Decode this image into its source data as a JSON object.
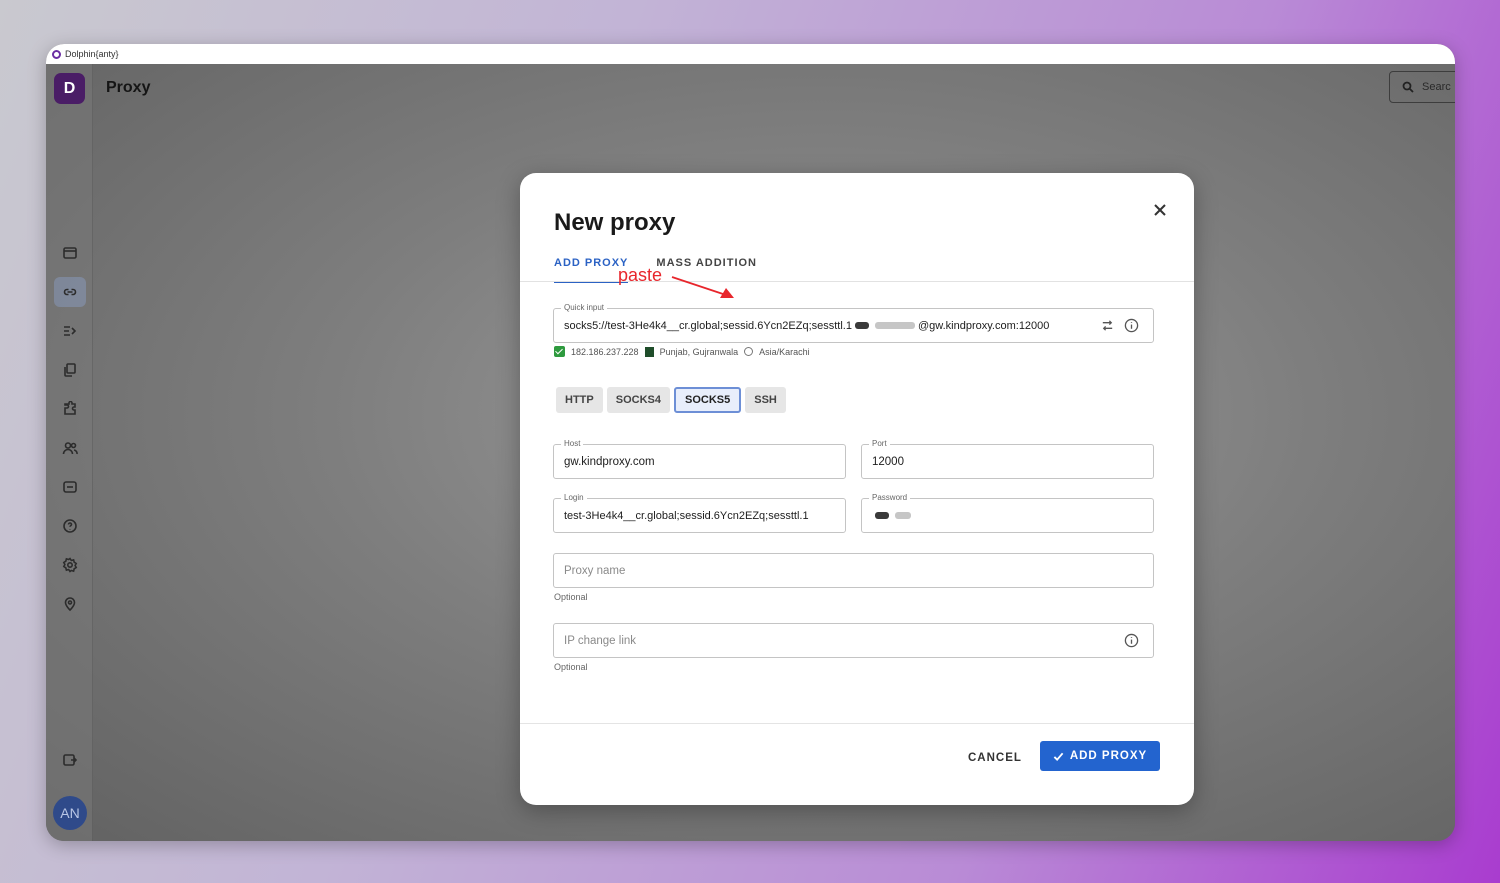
{
  "window": {
    "title": "Dolphin{anty}"
  },
  "header": {
    "page_title": "Proxy",
    "search_placeholder": "Searc"
  },
  "sidebar": {
    "logo_letter": "D",
    "items": [
      {
        "icon": "browser-window-icon"
      },
      {
        "icon": "link-icon",
        "active": true
      },
      {
        "icon": "list-arrow-icon"
      },
      {
        "icon": "copy-icon"
      },
      {
        "icon": "extension-icon"
      },
      {
        "icon": "users-icon"
      },
      {
        "icon": "api-icon"
      },
      {
        "icon": "help-icon"
      },
      {
        "icon": "settings-icon"
      },
      {
        "icon": "location-icon"
      }
    ],
    "bottom_icon": "exit-icon",
    "avatar_initials": "AN"
  },
  "modal": {
    "title": "New proxy",
    "tabs": [
      {
        "label": "ADD PROXY",
        "active": true
      },
      {
        "label": "MASS ADDITION",
        "active": false
      }
    ],
    "annotation": "paste",
    "quick_input": {
      "label": "Quick input",
      "value_start": "socks5://test-3He4k4__cr.global;sessid.6Ycn2EZq;sessttl.1",
      "value_end": "@gw.kindproxy.com:12000"
    },
    "check_info": {
      "ip": "182.186.237.228",
      "location": "Punjab, Gujranwala",
      "timezone": "Asia/Karachi"
    },
    "protocols": [
      {
        "label": "HTTP",
        "selected": false
      },
      {
        "label": "SOCKS4",
        "selected": false
      },
      {
        "label": "SOCKS5",
        "selected": true
      },
      {
        "label": "SSH",
        "selected": false
      }
    ],
    "host": {
      "label": "Host",
      "value": "gw.kindproxy.com"
    },
    "port": {
      "label": "Port",
      "value": "12000"
    },
    "login": {
      "label": "Login",
      "value": "test-3He4k4__cr.global;sessid.6Ycn2EZq;sessttl.1"
    },
    "password": {
      "label": "Password"
    },
    "proxy_name": {
      "placeholder": "Proxy name",
      "helper": "Optional"
    },
    "ip_change_link": {
      "placeholder": "IP change link",
      "helper": "Optional"
    },
    "cancel_label": "CANCEL",
    "add_label": "ADD PROXY"
  },
  "colors": {
    "accent": "#2364cf",
    "annotation": "#e8262c",
    "brand": "#4a1d66"
  }
}
